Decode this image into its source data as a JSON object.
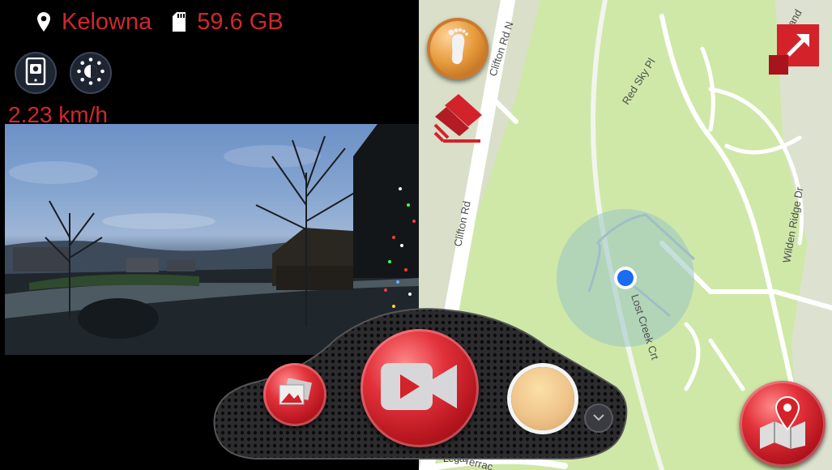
{
  "status": {
    "location_icon": "location-pin-icon",
    "location": "Kelowna",
    "storage_icon": "sd-card-icon",
    "storage": "59.6 GB"
  },
  "controls": {
    "camera_switch_icon": "phone-camera-icon",
    "brightness_icon": "brightness-icon",
    "speed": "2.23 km/h"
  },
  "map": {
    "roads": [
      "Clifton Rd N",
      "Clifton Rd",
      "Red Sky Pl",
      "Skyland",
      "Wilden Ridge Dr",
      "Lost Creek Crt",
      "Terrac"
    ],
    "footprint_icon": "footprint-icon",
    "expand_icon": "expand-arrow-icon",
    "layers_icon": "map-layers-icon",
    "map_button_icon": "map-pin-icon",
    "legal": "Legal"
  },
  "dock": {
    "gallery_icon": "photo-gallery-icon",
    "record_icon": "video-camera-icon",
    "shutter_icon": "capture-button",
    "chevron_icon": "chevron-down-icon"
  },
  "colors": {
    "accent_red": "#d0272d",
    "map_green": "#cfe8a8",
    "location_blue": "#1a6cf0"
  }
}
